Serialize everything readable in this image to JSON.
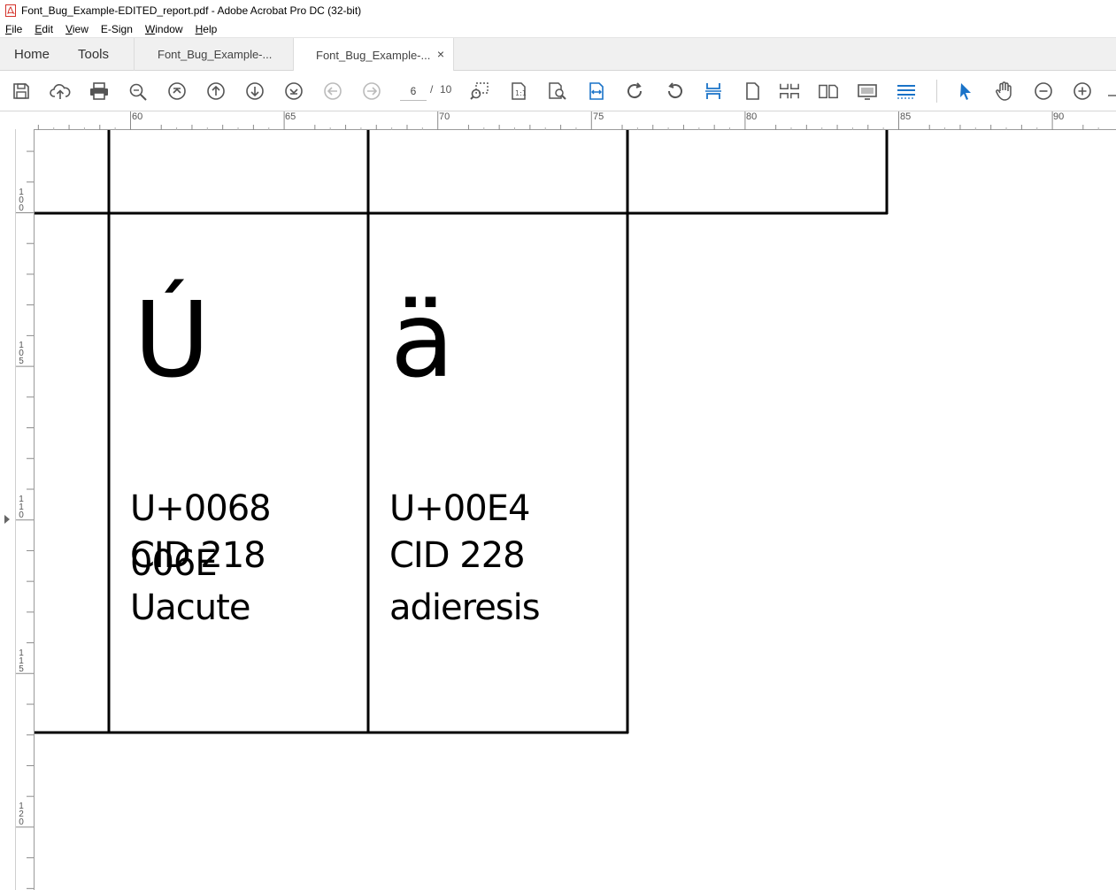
{
  "window": {
    "title": "Font_Bug_Example-EDITED_report.pdf - Adobe Acrobat Pro DC (32-bit)"
  },
  "menu": {
    "items": [
      {
        "u": "F",
        "rest": "ile"
      },
      {
        "u": "E",
        "rest": "dit"
      },
      {
        "u": "V",
        "rest": "iew"
      },
      {
        "u": "",
        "rest": "E-Sign"
      },
      {
        "u": "W",
        "rest": "indow"
      },
      {
        "u": "H",
        "rest": "elp"
      }
    ]
  },
  "tabs": {
    "home": "Home",
    "tools": "Tools",
    "doc1": "Font_Bug_Example-...",
    "doc2": "Font_Bug_Example-...",
    "close": "×"
  },
  "toolbar": {
    "current_page": "6",
    "separator": "/",
    "total_pages": "10"
  },
  "ruler": {
    "h_labels": [
      "60",
      "65",
      "70",
      "75",
      "80",
      "85",
      "90"
    ],
    "v_labels": [
      [
        "1",
        "0",
        "0"
      ],
      [
        "1",
        "0",
        "5"
      ],
      [
        "1",
        "1",
        "0"
      ],
      [
        "1",
        "1",
        "5"
      ],
      [
        "1",
        "2",
        "0"
      ]
    ]
  },
  "document": {
    "cell1": {
      "glyph": "Ú",
      "line1": "U+0068",
      "line2": "CID 218",
      "overlap": "006E",
      "line3": "Uacute"
    },
    "cell2": {
      "glyph": "ä",
      "line1": "U+00E4",
      "line2": "CID 228",
      "line3": "adieresis"
    }
  }
}
